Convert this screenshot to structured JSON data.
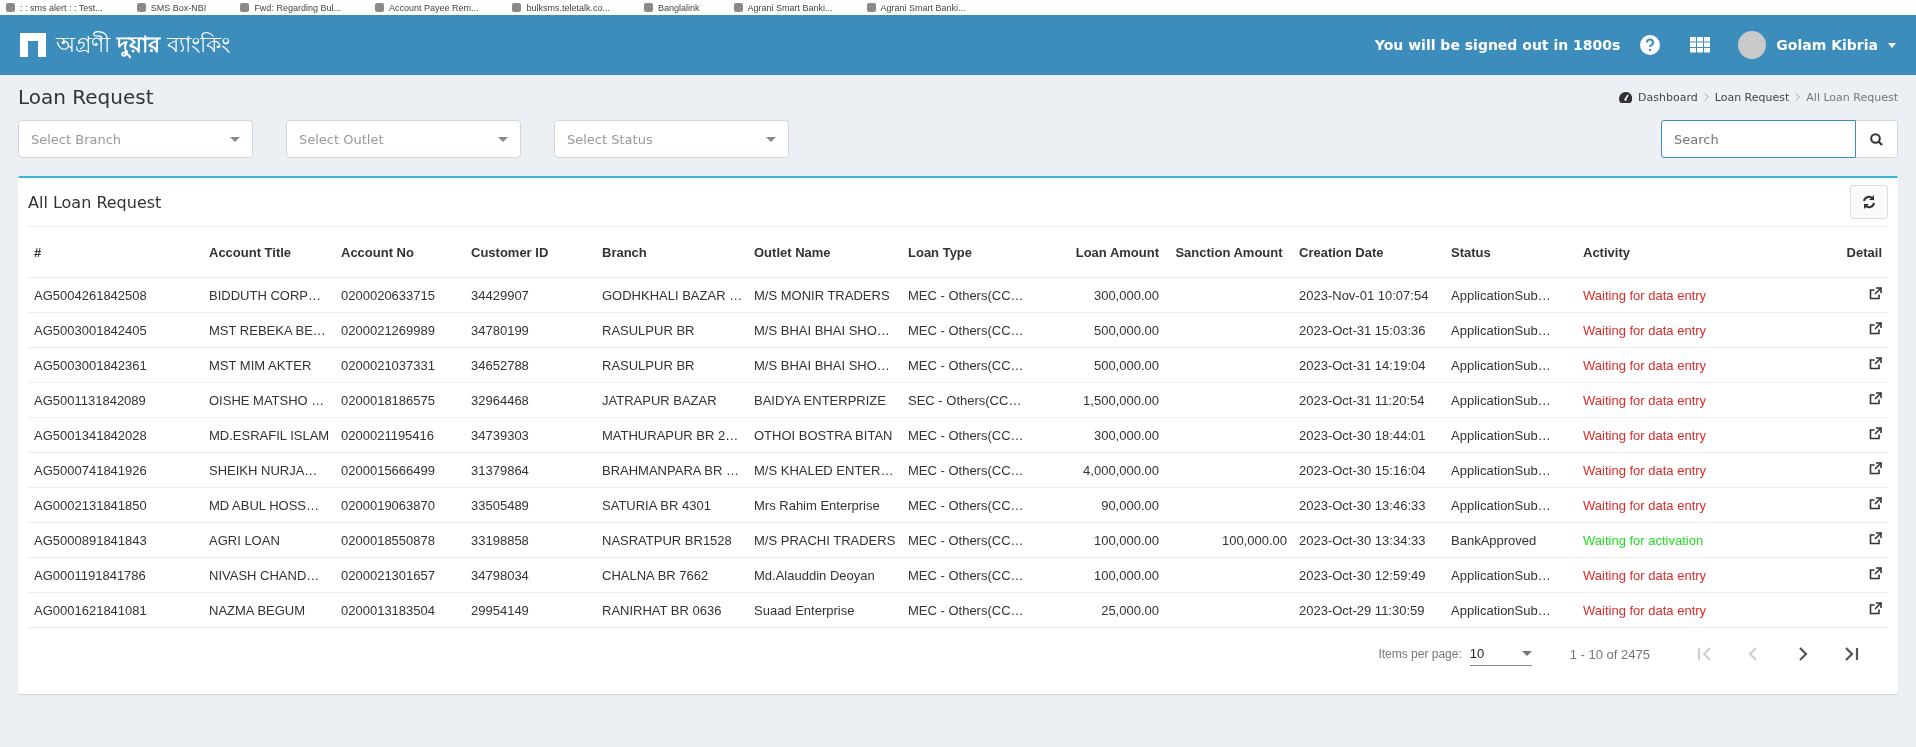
{
  "bookmarks": [
    ": : sms alert : : Test...",
    "SMS Box-NBI",
    "Fwd: Regarding Bul...",
    "Account Payee Rem...",
    "bulksms.teletalk.co...",
    "Banglalink",
    "Agrani Smart Banki...",
    "Agrani Smart Banki..."
  ],
  "header": {
    "brand": "অগ্রণী **দুয়ার** ব্যাংকিং",
    "session_text": "You will be signed out in 1800s",
    "user": "Golam Kibria"
  },
  "page": {
    "title": "Loan Request",
    "breadcrumbs": [
      "Dashboard",
      "Loan Request",
      "All Loan Request"
    ]
  },
  "filters": [
    {
      "placeholder": "Select Branch"
    },
    {
      "placeholder": "Select Outlet"
    },
    {
      "placeholder": "Select Status"
    }
  ],
  "search": {
    "placeholder": "Search"
  },
  "panel": {
    "title": "All Loan Request"
  },
  "table": {
    "columns": [
      "#",
      "Account Title",
      "Account No",
      "Customer ID",
      "Branch",
      "Outlet Name",
      "Loan Type",
      "Loan Amount",
      "Sanction Amount",
      "Creation Date",
      "Status",
      "Activity",
      "Detail"
    ],
    "rows": [
      {
        "id": "AG5004261842508",
        "title": "BIDDUTH CORP…",
        "account": "0200020633715",
        "customer": "34429907",
        "branch": "GODHKHALI BAZAR …",
        "outlet": "M/S MONIR TRADERS",
        "loan_type": "MEC - Others(CC…",
        "amount": "300,000.00",
        "sanction": "",
        "created": "2023-Nov-01 10:07:54",
        "status": "ApplicationSub…",
        "activity": "Waiting for data entry",
        "color": "#dd2a2a"
      },
      {
        "id": "AG5003001842405",
        "title": "MST REBEKA BE…",
        "account": "0200021269989",
        "customer": "34780199",
        "branch": "RASULPUR BR",
        "outlet": "M/S BHAI BHAI SHO…",
        "loan_type": "MEC - Others(CC…",
        "amount": "500,000.00",
        "sanction": "",
        "created": "2023-Oct-31 15:03:36",
        "status": "ApplicationSub…",
        "activity": "Waiting for data entry",
        "color": "#dd2a2a"
      },
      {
        "id": "AG5003001842361",
        "title": "MST MIM AKTER",
        "account": "0200021037331",
        "customer": "34652788",
        "branch": "RASULPUR BR",
        "outlet": "M/S BHAI BHAI SHO…",
        "loan_type": "MEC - Others(CC…",
        "amount": "500,000.00",
        "sanction": "",
        "created": "2023-Oct-31 14:19:04",
        "status": "ApplicationSub…",
        "activity": "Waiting for data entry",
        "color": "#dd2a2a"
      },
      {
        "id": "AG5001131842089",
        "title": "OISHE MATSHO …",
        "account": "0200018186575",
        "customer": "32964468",
        "branch": "JATRAPUR BAZAR",
        "outlet": "BAIDYA ENTERPRIZE",
        "loan_type": "SEC - Others(CC…",
        "amount": "1,500,000.00",
        "sanction": "",
        "created": "2023-Oct-31 11:20:54",
        "status": "ApplicationSub…",
        "activity": "Waiting for data entry",
        "color": "#dd2a2a"
      },
      {
        "id": "AG5001341842028",
        "title": "MD.ESRAFIL ISLAM",
        "account": "0200021195416",
        "customer": "34739303",
        "branch": "MATHURAPUR BR 2…",
        "outlet": "OTHOI BOSTRA BITAN",
        "loan_type": "MEC - Others(CC…",
        "amount": "300,000.00",
        "sanction": "",
        "created": "2023-Oct-30 18:44:01",
        "status": "ApplicationSub…",
        "activity": "Waiting for data entry",
        "color": "#dd2a2a"
      },
      {
        "id": "AG5000741841926",
        "title": "SHEIKH NURJA…",
        "account": "0200015666499",
        "customer": "31379864",
        "branch": "BRAHMANPARA BR …",
        "outlet": "M/S KHALED ENTER…",
        "loan_type": "MEC - Others(CC…",
        "amount": "4,000,000.00",
        "sanction": "",
        "created": "2023-Oct-30 15:16:04",
        "status": "ApplicationSub…",
        "activity": "Waiting for data entry",
        "color": "#dd2a2a"
      },
      {
        "id": "AG0002131841850",
        "title": "MD ABUL HOSS…",
        "account": "0200019063870",
        "customer": "33505489",
        "branch": "SATURIA BR 4301",
        "outlet": "Mrs Rahim Enterprise",
        "loan_type": "MEC - Others(CC…",
        "amount": "90,000.00",
        "sanction": "",
        "created": "2023-Oct-30 13:46:33",
        "status": "ApplicationSub…",
        "activity": "Waiting for data entry",
        "color": "#dd2a2a"
      },
      {
        "id": "AG5000891841843",
        "title": "AGRI LOAN",
        "account": "0200018550878",
        "customer": "33198858",
        "branch": "NASRATPUR BR1528",
        "outlet": "M/S PRACHI TRADERS",
        "loan_type": "MEC - Others(CC…",
        "amount": "100,000.00",
        "sanction": "100,000.00",
        "created": "2023-Oct-30 13:34:33",
        "status": "BankApproved",
        "activity": "Waiting for activation",
        "color": "#22dd22"
      },
      {
        "id": "AG0001191841786",
        "title": "NIVASH CHAND…",
        "account": "0200021301657",
        "customer": "34798034",
        "branch": "CHALNA BR 7662",
        "outlet": "Md.Alauddin Deoyan",
        "loan_type": "MEC - Others(CC…",
        "amount": "100,000.00",
        "sanction": "",
        "created": "2023-Oct-30 12:59:49",
        "status": "ApplicationSub…",
        "activity": "Waiting for data entry",
        "color": "#dd2a2a"
      },
      {
        "id": "AG0001621841081",
        "title": "NAZMA BEGUM",
        "account": "0200013183504",
        "customer": "29954149",
        "branch": "RANIRHAT BR 0636",
        "outlet": "Suaad Enterprise",
        "loan_type": "MEC - Others(CC…",
        "amount": "25,000.00",
        "sanction": "",
        "created": "2023-Oct-29 11:30:59",
        "status": "ApplicationSub…",
        "activity": "Waiting for data entry",
        "color": "#dd2a2a"
      }
    ]
  },
  "pagination": {
    "items_label": "Items per page:",
    "page_size": "10",
    "range": "1 - 10 of 2475",
    "buttons": [
      {
        "kind": "first",
        "disabled": true
      },
      {
        "kind": "prev",
        "disabled": true
      },
      {
        "kind": "next",
        "disabled": false
      },
      {
        "kind": "last",
        "disabled": false
      }
    ]
  }
}
